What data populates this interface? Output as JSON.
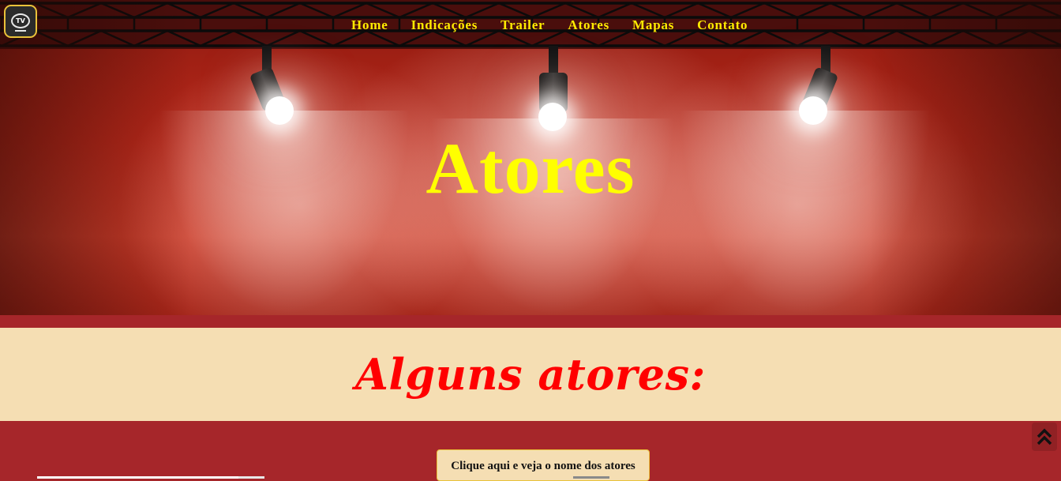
{
  "logo": {
    "icon": "tv-icon",
    "text": "TV"
  },
  "nav": {
    "items": [
      "Home",
      "Indicações",
      "Trailer",
      "Atores",
      "Mapas",
      "Contato"
    ]
  },
  "hero": {
    "title": "Atores"
  },
  "section": {
    "title": "Alguns atores:"
  },
  "actors_button": {
    "label": "Clique aqui e veja o nome dos atores"
  },
  "scroll_top": {
    "icon": "double-chevron-up-icon"
  },
  "colors": {
    "nav_text": "#ffeb00",
    "hero_title": "#ffff00",
    "banner_bg": "#f5deb3",
    "banner_title": "#ff0000",
    "page_bg": "#a6262a"
  }
}
